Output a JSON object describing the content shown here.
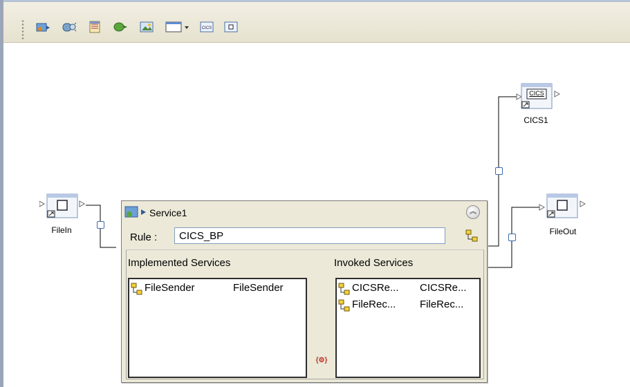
{
  "toolbar": {
    "buttons": [
      {
        "icon": "service-icon"
      },
      {
        "icon": "adapter-icon"
      },
      {
        "icon": "table-icon"
      },
      {
        "icon": "queue-icon"
      },
      {
        "icon": "image-icon"
      },
      {
        "icon": "window-dropdown-icon"
      },
      {
        "icon": "cics-icon"
      },
      {
        "icon": "file-icon"
      }
    ]
  },
  "canvas": {
    "components": {
      "filein": {
        "label": "FileIn"
      },
      "cics1": {
        "label": "CICS1",
        "badge": "CICS"
      },
      "fileout": {
        "label": "FileOut"
      }
    },
    "service": {
      "title": "Service1",
      "rule_label": "Rule :",
      "rule_value": "CICS_BP",
      "implemented_title": "Implemented Services",
      "invoked_title": "Invoked Services",
      "implemented": [
        {
          "col1": "FileSender",
          "col2": "FileSender"
        }
      ],
      "invoked": [
        {
          "col1": "CICSRe...",
          "col2": "CICSRe..."
        },
        {
          "col1": "FileRec...",
          "col2": "FileRec..."
        }
      ]
    }
  }
}
